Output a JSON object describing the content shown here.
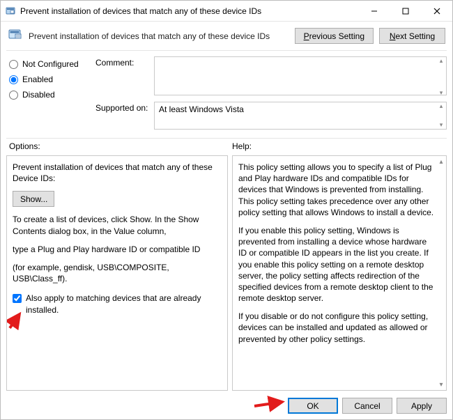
{
  "title": "Prevent installation of devices that match any of these device IDs",
  "header": {
    "title": "Prevent installation of devices that match any of these device IDs",
    "prev_button": "Previous Setting",
    "next_button": "Next Setting"
  },
  "state": {
    "not_configured_label": "Not Configured",
    "enabled_label": "Enabled",
    "disabled_label": "Disabled",
    "selected": "Enabled"
  },
  "comment": {
    "label": "Comment:",
    "value": ""
  },
  "supported": {
    "label": "Supported on:",
    "value": "At least Windows Vista"
  },
  "section_labels": {
    "options": "Options:",
    "help": "Help:"
  },
  "options_panel": {
    "title": "Prevent installation of devices that match any of these Device IDs:",
    "show_button": "Show...",
    "instr1": "To create a list of devices, click Show. In the Show Contents dialog box, in the Value column,",
    "instr2": "type a Plug and Play hardware ID or compatible ID",
    "instr3": "(for example, gendisk, USB\\COMPOSITE, USB\\Class_ff).",
    "checkbox_label": "Also apply to matching devices that are already installed.",
    "checkbox_checked": true
  },
  "help_panel": {
    "p1": "This policy setting allows you to specify a list of Plug and Play hardware IDs and compatible IDs for devices that Windows is prevented from installing. This policy setting takes precedence over any other policy setting that allows Windows to install a device.",
    "p2": "If you enable this policy setting, Windows is prevented from installing a device whose hardware ID or compatible ID appears in the list you create. If you enable this policy setting on a remote desktop server, the policy setting affects redirection of the specified devices from a remote desktop client to the remote desktop server.",
    "p3": "If you disable or do not configure this policy setting, devices can be installed and updated as allowed or prevented by other policy settings."
  },
  "buttons": {
    "ok": "OK",
    "cancel": "Cancel",
    "apply": "Apply"
  }
}
